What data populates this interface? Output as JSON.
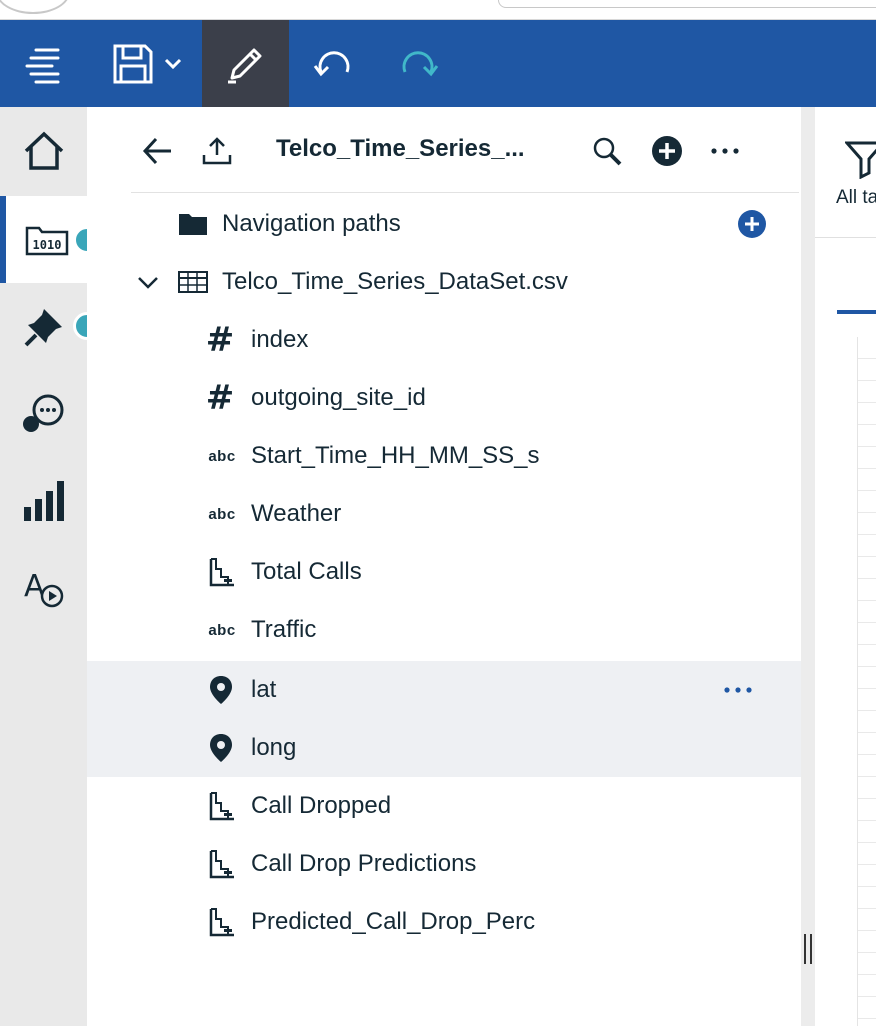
{
  "toolbar": {
    "icons": [
      "menu-icon",
      "save-icon",
      "chevron-down-icon",
      "edit-icon",
      "undo-icon",
      "redo-icon"
    ],
    "accent": "#1f57a4",
    "active_bg": "#3b3f4a",
    "redo_color": "#41b8c9"
  },
  "rail": {
    "items": [
      {
        "name": "home",
        "icon": "home-icon"
      },
      {
        "name": "data",
        "icon": "data-source-icon",
        "selected": true
      },
      {
        "name": "pins",
        "icon": "pin-icon"
      },
      {
        "name": "assistant",
        "icon": "chat-icon"
      },
      {
        "name": "visualizations",
        "icon": "bar-chart-icon"
      },
      {
        "name": "navigation",
        "icon": "text-play-icon"
      }
    ],
    "dot_color": "#3aa6b9"
  },
  "panel": {
    "title": "Telco_Time_Series_...",
    "header_icons": [
      "back-arrow-icon",
      "upload-icon",
      "search-icon",
      "add-icon",
      "more-icon"
    ]
  },
  "tree": {
    "navigation_paths": "Navigation paths",
    "dataset": "Telco_Time_Series_DataSet.csv",
    "columns": [
      {
        "label": "index",
        "type": "hash"
      },
      {
        "label": "outgoing_site_id",
        "type": "hash"
      },
      {
        "label": "Start_Time_HH_MM_SS_s",
        "type": "abc"
      },
      {
        "label": "Weather",
        "type": "abc"
      },
      {
        "label": "Total Calls",
        "type": "measure"
      },
      {
        "label": "Traffic",
        "type": "abc"
      },
      {
        "label": "lat",
        "type": "geo",
        "selected": true
      },
      {
        "label": "long",
        "type": "geo",
        "selected": true
      },
      {
        "label": "Call Dropped",
        "type": "measure"
      },
      {
        "label": "Call Drop Predictions",
        "type": "measure"
      },
      {
        "label": "Predicted_Call_Drop_Perc",
        "type": "measure"
      }
    ],
    "type_labels": {
      "abc": "abc",
      "hash": "#"
    }
  },
  "right": {
    "filter_label": "All ta"
  }
}
